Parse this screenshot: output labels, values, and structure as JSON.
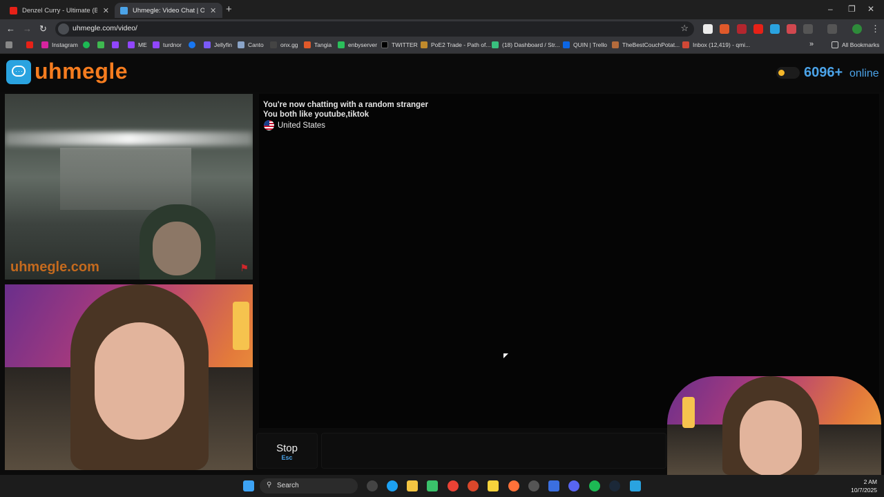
{
  "browser": {
    "tabs": [
      {
        "title": "Denzel Curry - Ultimate (BADB/",
        "close": "✕",
        "color": "#e62117"
      },
      {
        "title": "Uhmegle: Video Chat | Onl",
        "close": "✕",
        "color": "#4ba3e8"
      }
    ],
    "new_tab": "+",
    "url": "uhmegle.com/video/",
    "window_controls": {
      "minimize": "–",
      "restore": "❐",
      "close": "✕"
    },
    "nav": {
      "back": "←",
      "forward": "→",
      "reload": "↻"
    },
    "bookmarks": [
      {
        "label": "",
        "color": "#e62117"
      },
      {
        "label": "Instagram",
        "color": "#d6249f"
      },
      {
        "label": "",
        "color": "#1db954"
      },
      {
        "label": "",
        "color": "#3fb950"
      },
      {
        "label": "",
        "color": "#9146ff"
      },
      {
        "label": "ME",
        "color": "#9146ff"
      },
      {
        "label": "turdnor",
        "color": "#9146ff"
      },
      {
        "label": "",
        "color": "#1877f2"
      },
      {
        "label": "Jellyfin",
        "color": "#7a5af8"
      },
      {
        "label": "Canto",
        "color": "#8aa4c8"
      },
      {
        "label": "onx.gg",
        "color": "#444"
      },
      {
        "label": "Tangia",
        "color": "#e0592a"
      },
      {
        "label": "enbyserver",
        "color": "#2bbf5b"
      },
      {
        "label": "TWITTER",
        "color": "#000"
      },
      {
        "label": "PoE2 Trade - Path of...",
        "color": "#c08a2c"
      },
      {
        "label": "(18) Dashboard / Str...",
        "color": "#39c07f"
      },
      {
        "label": "QUIN | Trello",
        "color": "#0c66e4"
      },
      {
        "label": "TheBestCouchPotat...",
        "color": "#b36b3c"
      },
      {
        "label": "Inbox (12,419) - qmi...",
        "color": "#d14836"
      }
    ],
    "bookmarks_more": "»",
    "all_bookmarks": "All Bookmarks"
  },
  "site": {
    "logo_text": "uhmegle",
    "online_count": "6096+",
    "online_label": "online",
    "watermark": "uhmegle.com"
  },
  "chat": {
    "messages": [
      "You're now chatting with a random stranger",
      "You both like youtube,tiktok"
    ],
    "country": "United States"
  },
  "controls": {
    "stop_label": "Stop",
    "stop_shortcut": "Esc",
    "message_placeholder": ""
  },
  "taskbar": {
    "search_label": "Search",
    "time": "2 AM",
    "date": "10/7/2025"
  },
  "colors": {
    "accent_orange": "#f57c1f",
    "accent_blue": "#4ba3e8",
    "background": "#0a0a0a"
  }
}
